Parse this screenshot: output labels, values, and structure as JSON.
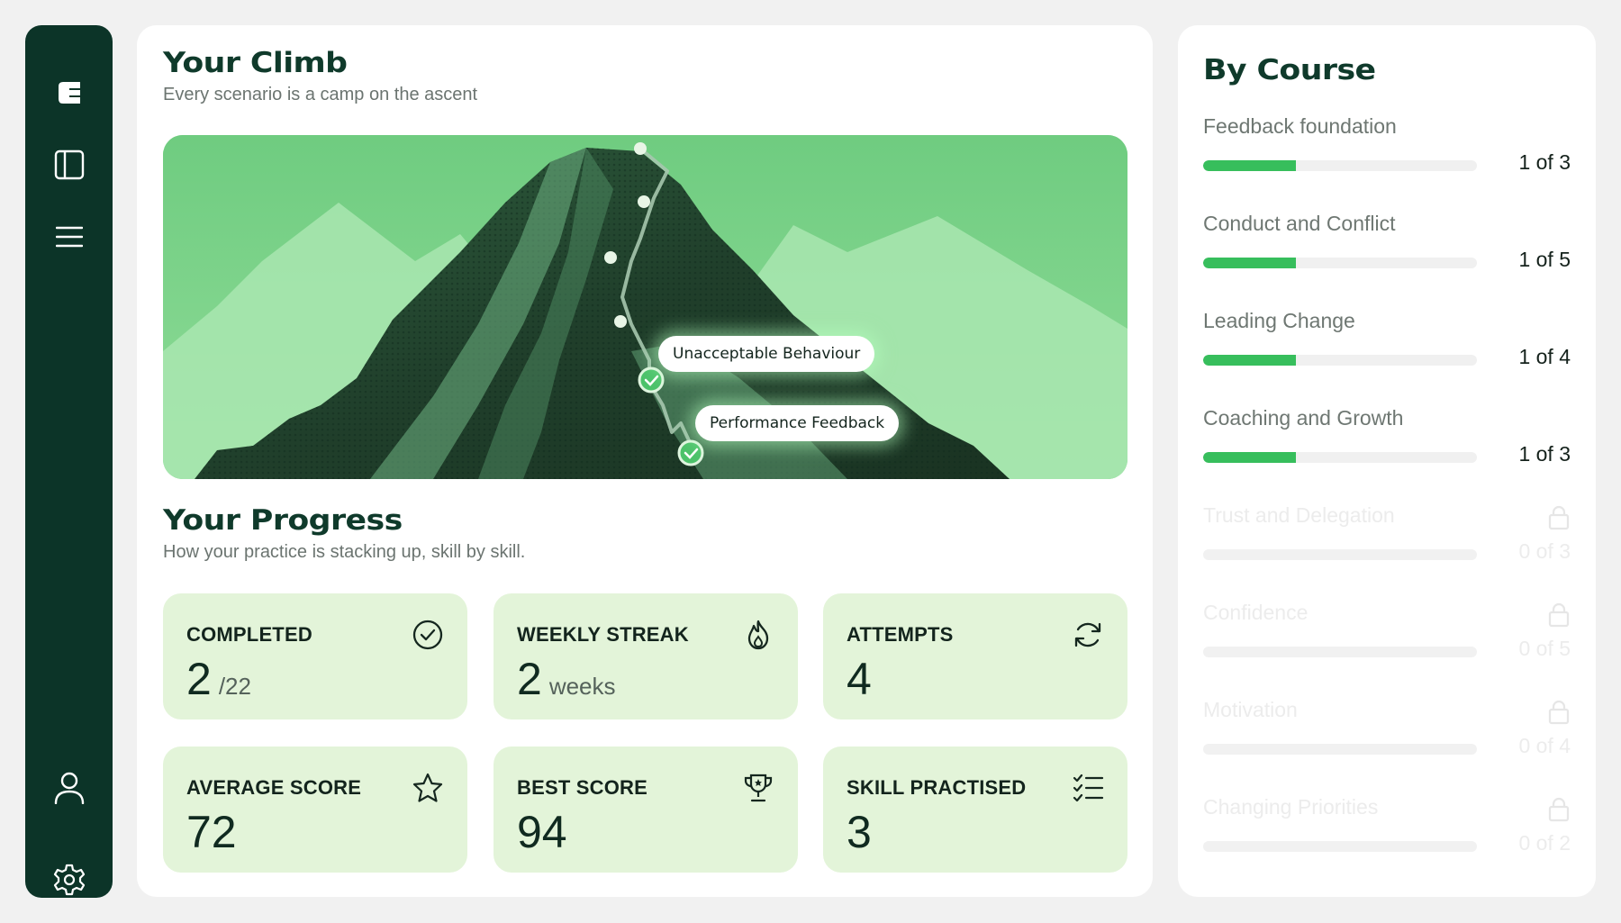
{
  "sidebar": {
    "icons": [
      "logo-icon",
      "panel-icon",
      "menu-icon",
      "user-icon",
      "settings-icon"
    ]
  },
  "climb": {
    "title": "Your Climb",
    "subtitle": "Every scenario is a camp on the ascent",
    "camps": [
      {
        "label": "Unacceptable Behaviour",
        "completed": true
      },
      {
        "label": "Performance Feedback",
        "completed": true
      }
    ]
  },
  "progress": {
    "title": "Your Progress",
    "subtitle": "How your practice is stacking up, skill by skill.",
    "stats": [
      {
        "label": "COMPLETED",
        "value": "2",
        "unit": "/22",
        "icon": "check-circle-icon"
      },
      {
        "label": "WEEKLY STREAK",
        "value": "2",
        "unit": "weeks",
        "icon": "flame-icon"
      },
      {
        "label": "ATTEMPTS",
        "value": "4",
        "unit": "",
        "icon": "refresh-icon"
      },
      {
        "label": "AVERAGE SCORE",
        "value": "72",
        "unit": "",
        "icon": "star-icon"
      },
      {
        "label": "BEST SCORE",
        "value": "94",
        "unit": "",
        "icon": "trophy-icon"
      },
      {
        "label": "SKILL PRACTISED",
        "value": "3",
        "unit": "",
        "icon": "checklist-icon"
      }
    ]
  },
  "courses": {
    "title": "By Course",
    "items": [
      {
        "name": "Feedback foundation",
        "count": "1 of 3",
        "progress": 0.34,
        "locked": false
      },
      {
        "name": "Conduct and Conflict",
        "count": "1 of 5",
        "progress": 0.34,
        "locked": false
      },
      {
        "name": "Leading Change",
        "count": "1 of 4",
        "progress": 0.34,
        "locked": false
      },
      {
        "name": "Coaching and Growth",
        "count": "1 of 3",
        "progress": 0.34,
        "locked": false
      },
      {
        "name": "Trust and Delegation",
        "count": "0 of 3",
        "progress": 0,
        "locked": true
      },
      {
        "name": "Confidence",
        "count": "0 of 5",
        "progress": 0,
        "locked": true
      },
      {
        "name": "Motivation",
        "count": "0 of 4",
        "progress": 0,
        "locked": true
      },
      {
        "name": "Changing Priorities",
        "count": "0 of 2",
        "progress": 0,
        "locked": true
      }
    ]
  },
  "colors": {
    "sidebar": "#0c3428",
    "accent": "#37be5c",
    "stat_card": "#e3f4d9",
    "hero_sky": "#72cd82"
  }
}
